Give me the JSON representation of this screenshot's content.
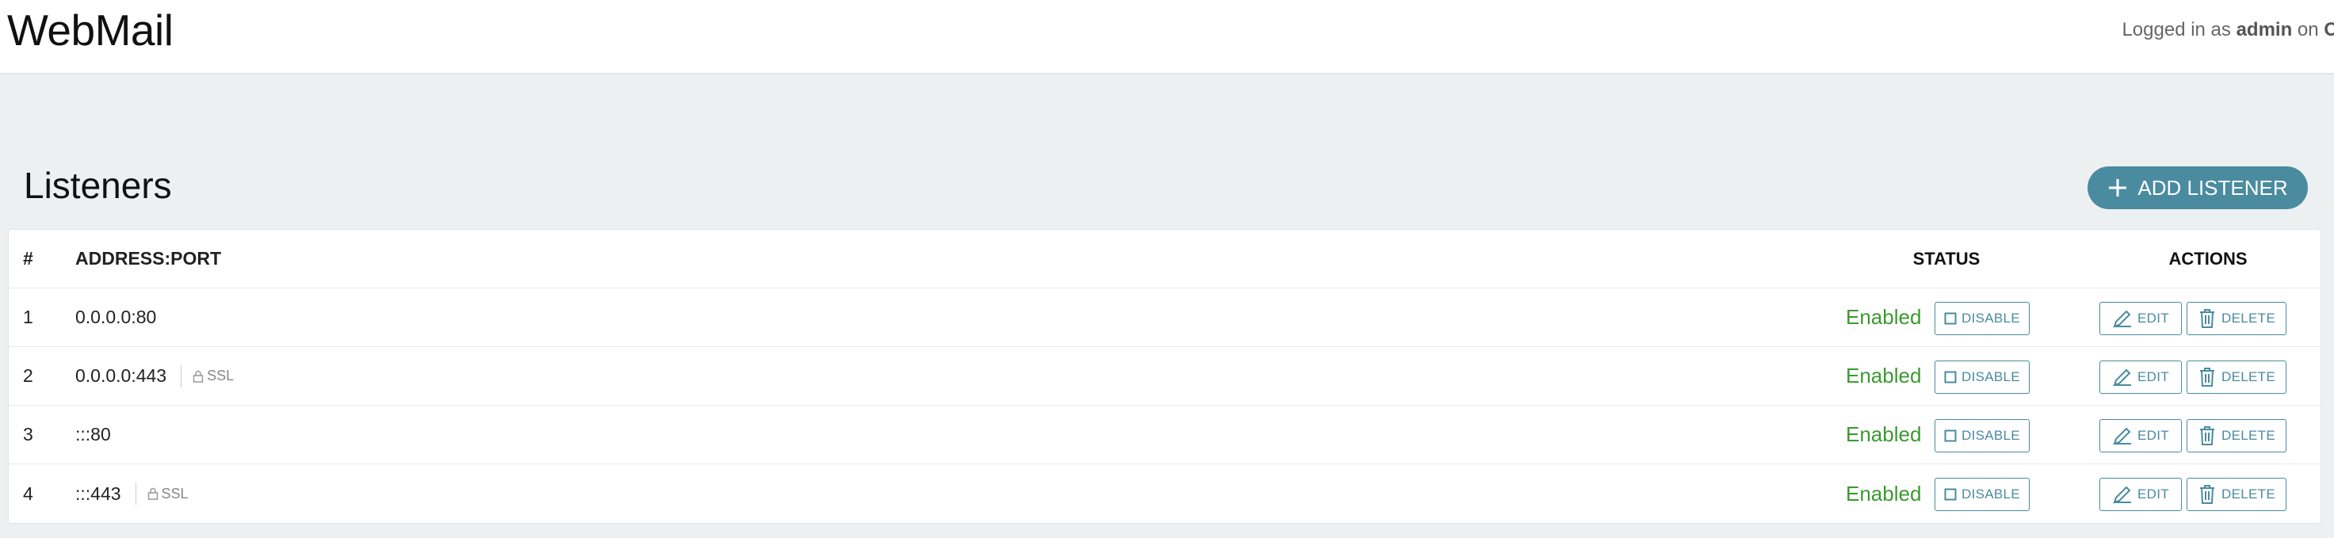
{
  "app": {
    "title": "WebMail",
    "login_prefix": "Logged in as ",
    "user": "admin",
    "login_mid": " on ",
    "server": "Orar"
  },
  "page": {
    "heading": "Listeners",
    "add_button_label": "ADD LISTENER"
  },
  "table": {
    "headers": {
      "num": "#",
      "address": "ADDRESS:PORT",
      "status": "STATUS",
      "actions": "ACTIONS"
    },
    "rows": [
      {
        "num": "1",
        "address": "0.0.0.0:80",
        "ssl": "",
        "status": "Enabled"
      },
      {
        "num": "2",
        "address": "0.0.0.0:443",
        "ssl": "SSL",
        "status": "Enabled"
      },
      {
        "num": "3",
        "address": ":::80",
        "ssl": "",
        "status": "Enabled"
      },
      {
        "num": "4",
        "address": ":::443",
        "ssl": "SSL",
        "status": "Enabled"
      }
    ],
    "disable_label": "DISABLE",
    "edit_label": "EDIT",
    "delete_label": "DELETE"
  },
  "colors": {
    "accent": "#4a8ba0",
    "enabled": "#3a9a2f",
    "background": "#ecf0f1"
  },
  "icons": [
    "plus-icon",
    "lock-icon",
    "square-icon",
    "pencil-icon",
    "trash-icon"
  ]
}
